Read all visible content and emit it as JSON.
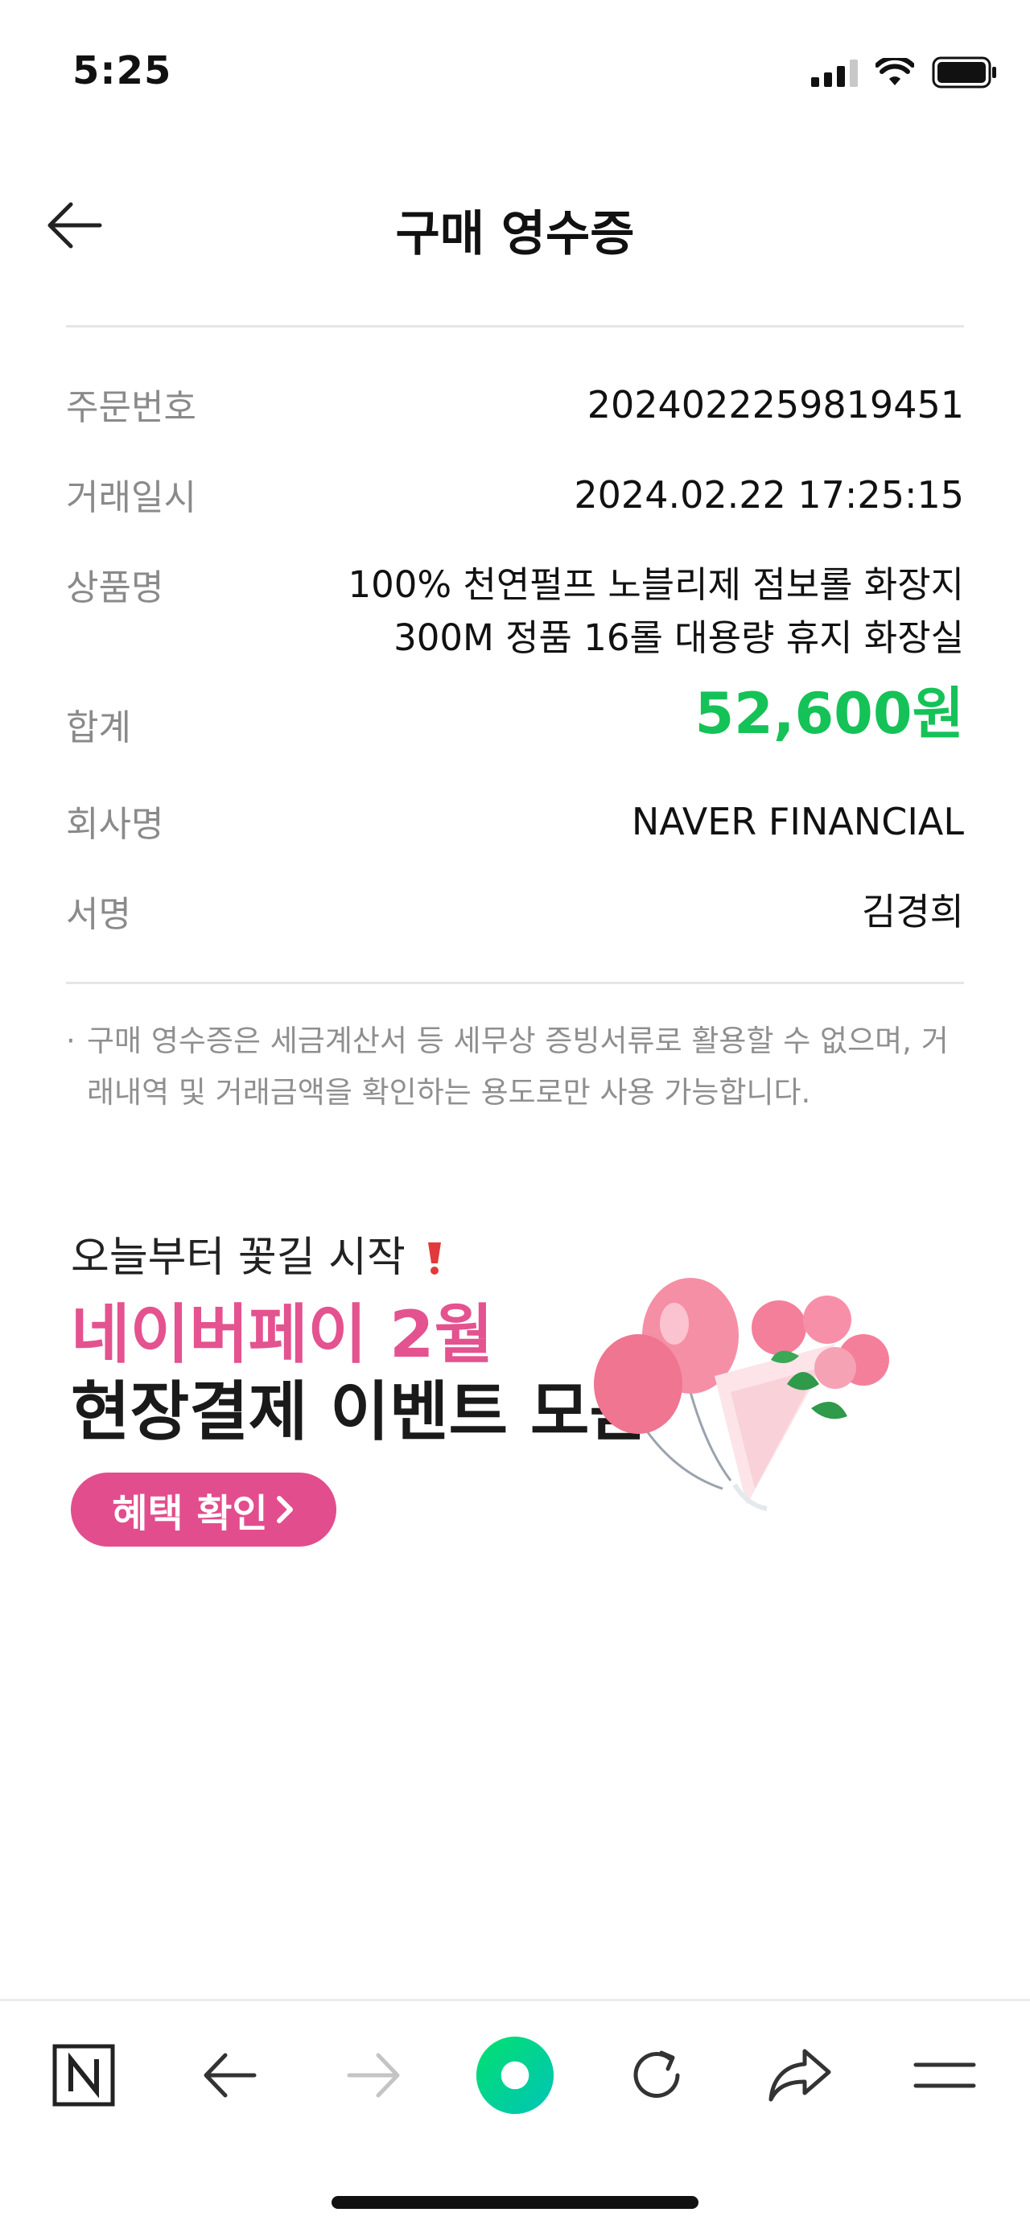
{
  "status_bar": {
    "time": "5:25"
  },
  "header": {
    "title": "구매 영수증"
  },
  "receipt": {
    "rows": [
      {
        "label": "주문번호",
        "value": "2024022259819451"
      },
      {
        "label": "거래일시",
        "value": "2024.02.22 17:25:15"
      },
      {
        "label": "상품명",
        "value": "100% 천연펄프 노블리제 점보롤 화장지 300M 정품 16롤 대용량 휴지 화장실"
      },
      {
        "label": "합계",
        "value": "52,600원"
      },
      {
        "label": "회사명",
        "value": "NAVER FINANCIAL"
      },
      {
        "label": "서명",
        "value": "김경희"
      }
    ],
    "note": "구매 영수증은 세금계산서 등 세무상 증빙서류로 활용할 수 없으며, 거래내역 및 거래금액을 확인하는 용도로만 사용 가능합니다."
  },
  "banner": {
    "line1": "오늘부터 꽃길 시작",
    "line2": "네이버페이 2월",
    "line3": "현장결제 이벤트 모음",
    "cta_label": "혜택 확인",
    "colors": {
      "accent": "#e4528f",
      "button": "#e24d8d"
    }
  },
  "colors": {
    "total": "#15c257",
    "label": "#8a8a8a",
    "green_button": "#03e06f"
  },
  "bottom_bar": {
    "icons": [
      "naver-home-icon",
      "back-arrow-icon",
      "forward-arrow-icon",
      "green-dot-button",
      "refresh-icon",
      "share-icon",
      "menu-icon"
    ]
  }
}
